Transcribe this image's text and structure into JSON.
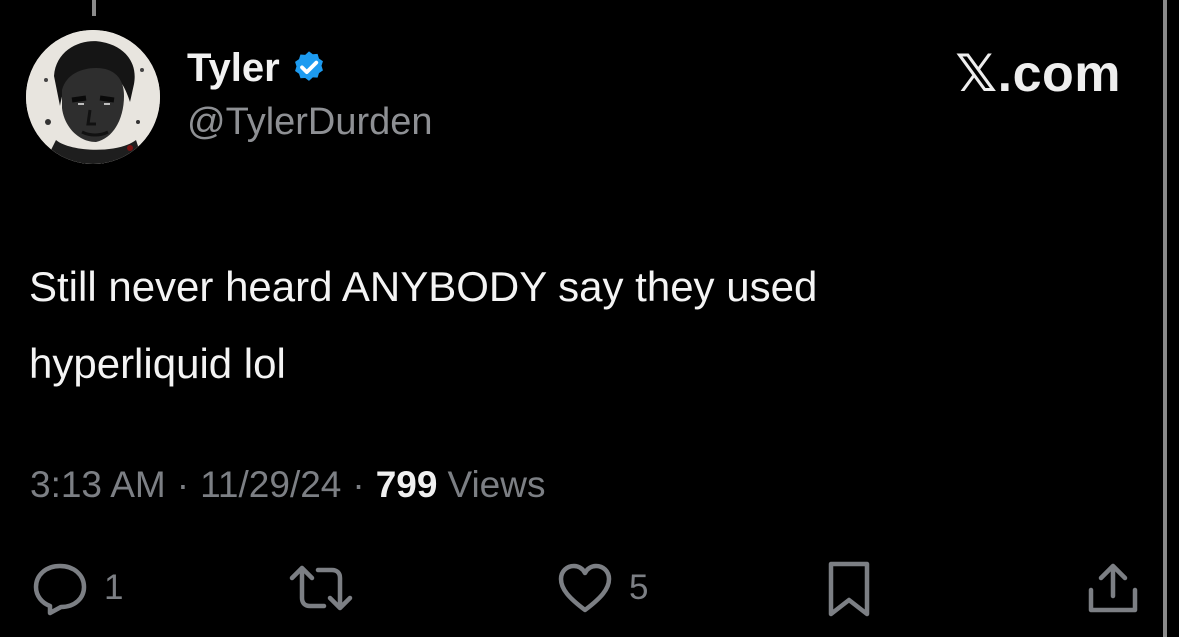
{
  "author": {
    "display_name": "Tyler",
    "handle": "@TylerDurden",
    "avatar_icon": "portrait-avatar",
    "verified_icon": "verified-badge-icon",
    "verified_color": "#1d9bf0"
  },
  "brand": "𝕏.com",
  "tweet": {
    "line1": "Still never heard ANYBODY say they used",
    "line2": "hyperliquid lol"
  },
  "meta": {
    "time": "3:13 AM",
    "separator": "·",
    "date": "11/29/24",
    "views_count": "799",
    "views_label": "Views"
  },
  "actions": {
    "reply_count": "1",
    "like_count": "5"
  },
  "colors": {
    "background": "#000000",
    "text_primary": "#e7e9ea",
    "text_secondary": "#7c7f84"
  }
}
